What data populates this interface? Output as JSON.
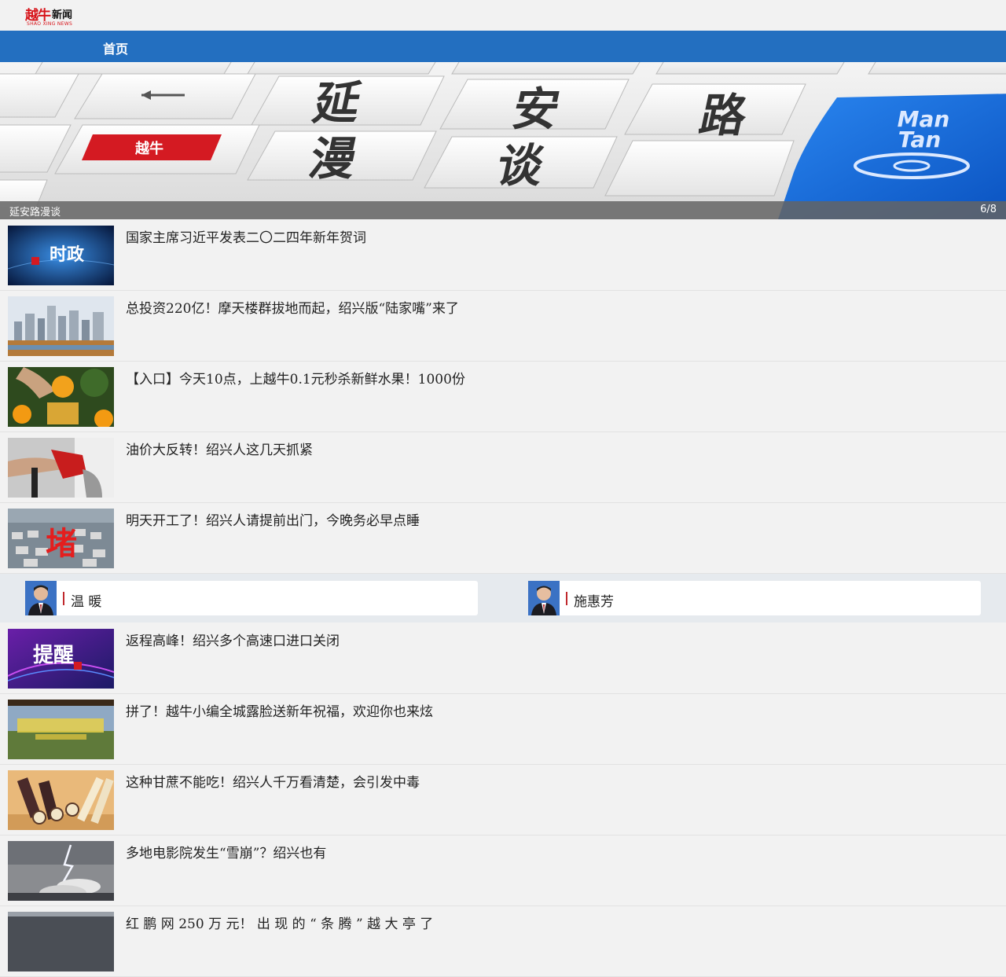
{
  "header": {
    "logo_mark": "越牛",
    "logo_word": "新闻",
    "logo_sub": "SHAO XING NEWS"
  },
  "nav": {
    "home_label": "首页"
  },
  "banner": {
    "caption": "延安路漫谈",
    "counter": "6/8",
    "keys": [
      "延",
      "安",
      "路",
      "漫",
      "谈"
    ],
    "badge_logo": "越牛",
    "blue_key_line1": "Man",
    "blue_key_line2": "Tan",
    "accent_color": "#1566d4"
  },
  "news_top": [
    {
      "title": "国家主席习近平发表二〇二四年新年贺词",
      "thumb_text": "时政",
      "thumb": "politics"
    },
    {
      "title": "总投资220亿！摩天楼群拔地而起，绍兴版“陆家嘴”来了",
      "thumb": "skyline"
    },
    {
      "title": "【入口】今天10点，上越牛0.1元秒杀新鲜水果！1000份",
      "thumb": "orange"
    },
    {
      "title": "油价大反转！绍兴人这几天抓紧",
      "thumb": "fuel"
    },
    {
      "title": "明天开工了！绍兴人请提前出门，今晚务必早点睡",
      "thumb_text": "堵",
      "thumb": "traffic"
    }
  ],
  "leaders": [
    {
      "name": "温  暖"
    },
    {
      "name": "施惠芳"
    }
  ],
  "news_bottom": [
    {
      "title": "返程高峰！绍兴多个高速口进口关闭",
      "thumb_text": "提醒",
      "thumb": "reminder"
    },
    {
      "title": "拼了！越牛小编全城露脸送新年祝福，欢迎你也来炫",
      "thumb": "greeting"
    },
    {
      "title": "这种甘蔗不能吃！绍兴人千万看清楚，会引发中毒",
      "thumb": "sugarcane"
    },
    {
      "title": "多地电影院发生“雪崩”？绍兴也有",
      "thumb": "storm"
    },
    {
      "title": "红 鹏 网 250 万 元！ 出 现 的 “ 条 腾 ” 越 大 亭 了",
      "thumb": "last"
    }
  ]
}
